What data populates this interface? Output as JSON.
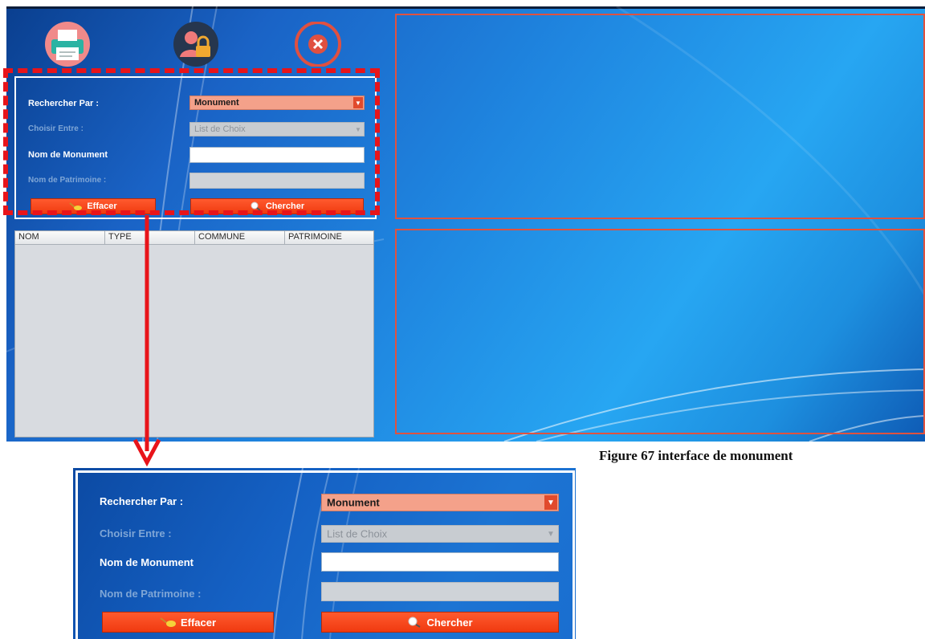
{
  "toolbar": {
    "icons": [
      {
        "name": "printer-icon",
        "color": "#2bb3a3"
      },
      {
        "name": "user-lock-icon",
        "color": "#f0a830"
      },
      {
        "name": "close-circle-icon",
        "color": "#e05040"
      }
    ]
  },
  "search_form": {
    "rechercher_par_label": "Rechercher Par :",
    "rechercher_par_value": "Monument",
    "choisir_entre_label": "Choisir Entre :",
    "choisir_entre_value": "List de Choix",
    "nom_monument_label": "Nom de Monument",
    "nom_monument_value": "",
    "nom_patrimoine_label": "Nom de Patrimoine :",
    "nom_patrimoine_value": "",
    "effacer_label": "Effacer",
    "chercher_label": "Chercher"
  },
  "results_table": {
    "columns": [
      "NOM",
      "TYPE",
      "COMMUNE",
      "PATRIMOINE"
    ],
    "rows": []
  },
  "caption": "Figure 67 interface de monument",
  "colors": {
    "accent_button": "#f24a1e",
    "highlight_dash": "#e8141a",
    "combo_active": "#f4a18a"
  }
}
